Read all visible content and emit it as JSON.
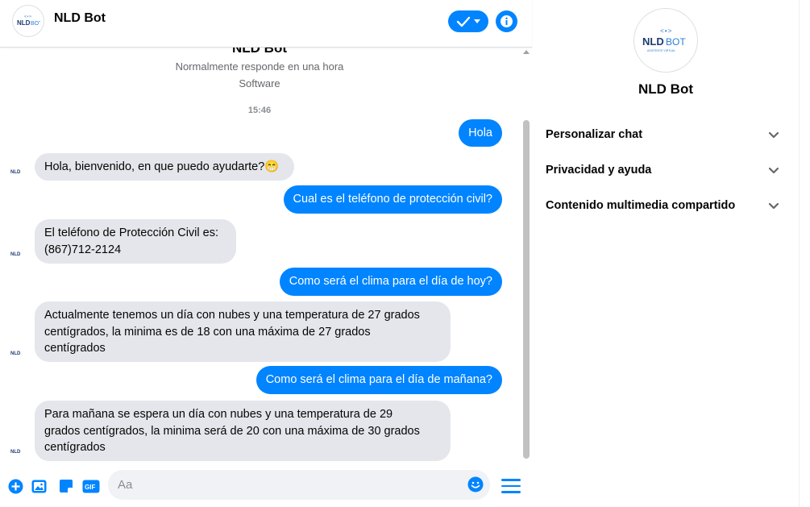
{
  "header": {
    "title": "NLD Bot"
  },
  "intro": {
    "name": "NLD Bot",
    "response_time": "Normalmente responde en una hora",
    "category": "Software",
    "timestamp": "15:46"
  },
  "messages": [
    {
      "from": "user",
      "text": "Hola"
    },
    {
      "from": "bot",
      "text": "Hola, bienvenido, en que puedo ayudarte?😁"
    },
    {
      "from": "user",
      "text": "Cual es el teléfono de protección civil?"
    },
    {
      "from": "bot",
      "lines": [
        "El teléfono de Protección Civil es:",
        "(867)712-2124"
      ]
    },
    {
      "from": "user",
      "text": "Como será el clima para el día de hoy?"
    },
    {
      "from": "bot",
      "lines": [
        "Actualmente tenemos un día con nubes y una temperatura de 27 grados",
        "centígrados, la minima es de 18 con una máxima de 27 grados",
        "centígrados"
      ]
    },
    {
      "from": "user",
      "text": "Como será el clima para el día de mañana?"
    },
    {
      "from": "bot",
      "lines": [
        "Para mañana se espera un día con nubes y una temperatura de 29",
        "grados centígrados, la minima será de 20 con una máxima de 30 grados",
        "centígrados"
      ]
    }
  ],
  "composer": {
    "placeholder": "Aa",
    "icons": [
      "plus-circle-icon",
      "photo-icon",
      "sticker-icon",
      "gif-icon",
      "emoji-icon",
      "menu-icon"
    ],
    "gif_label": "GIF"
  },
  "panel": {
    "name": "NLD Bot",
    "sections": [
      {
        "label": "Personalizar chat"
      },
      {
        "label": "Privacidad y ayuda"
      },
      {
        "label": "Contenido multimedia compartido"
      }
    ]
  },
  "logo": {
    "text": "NLDBOT",
    "tagline": "ASISTENTE VIRTUAL"
  },
  "colors": {
    "accent": "#0084ff",
    "bubble_in": "#e4e6eb",
    "text": "#050505",
    "muted": "#65676b"
  }
}
